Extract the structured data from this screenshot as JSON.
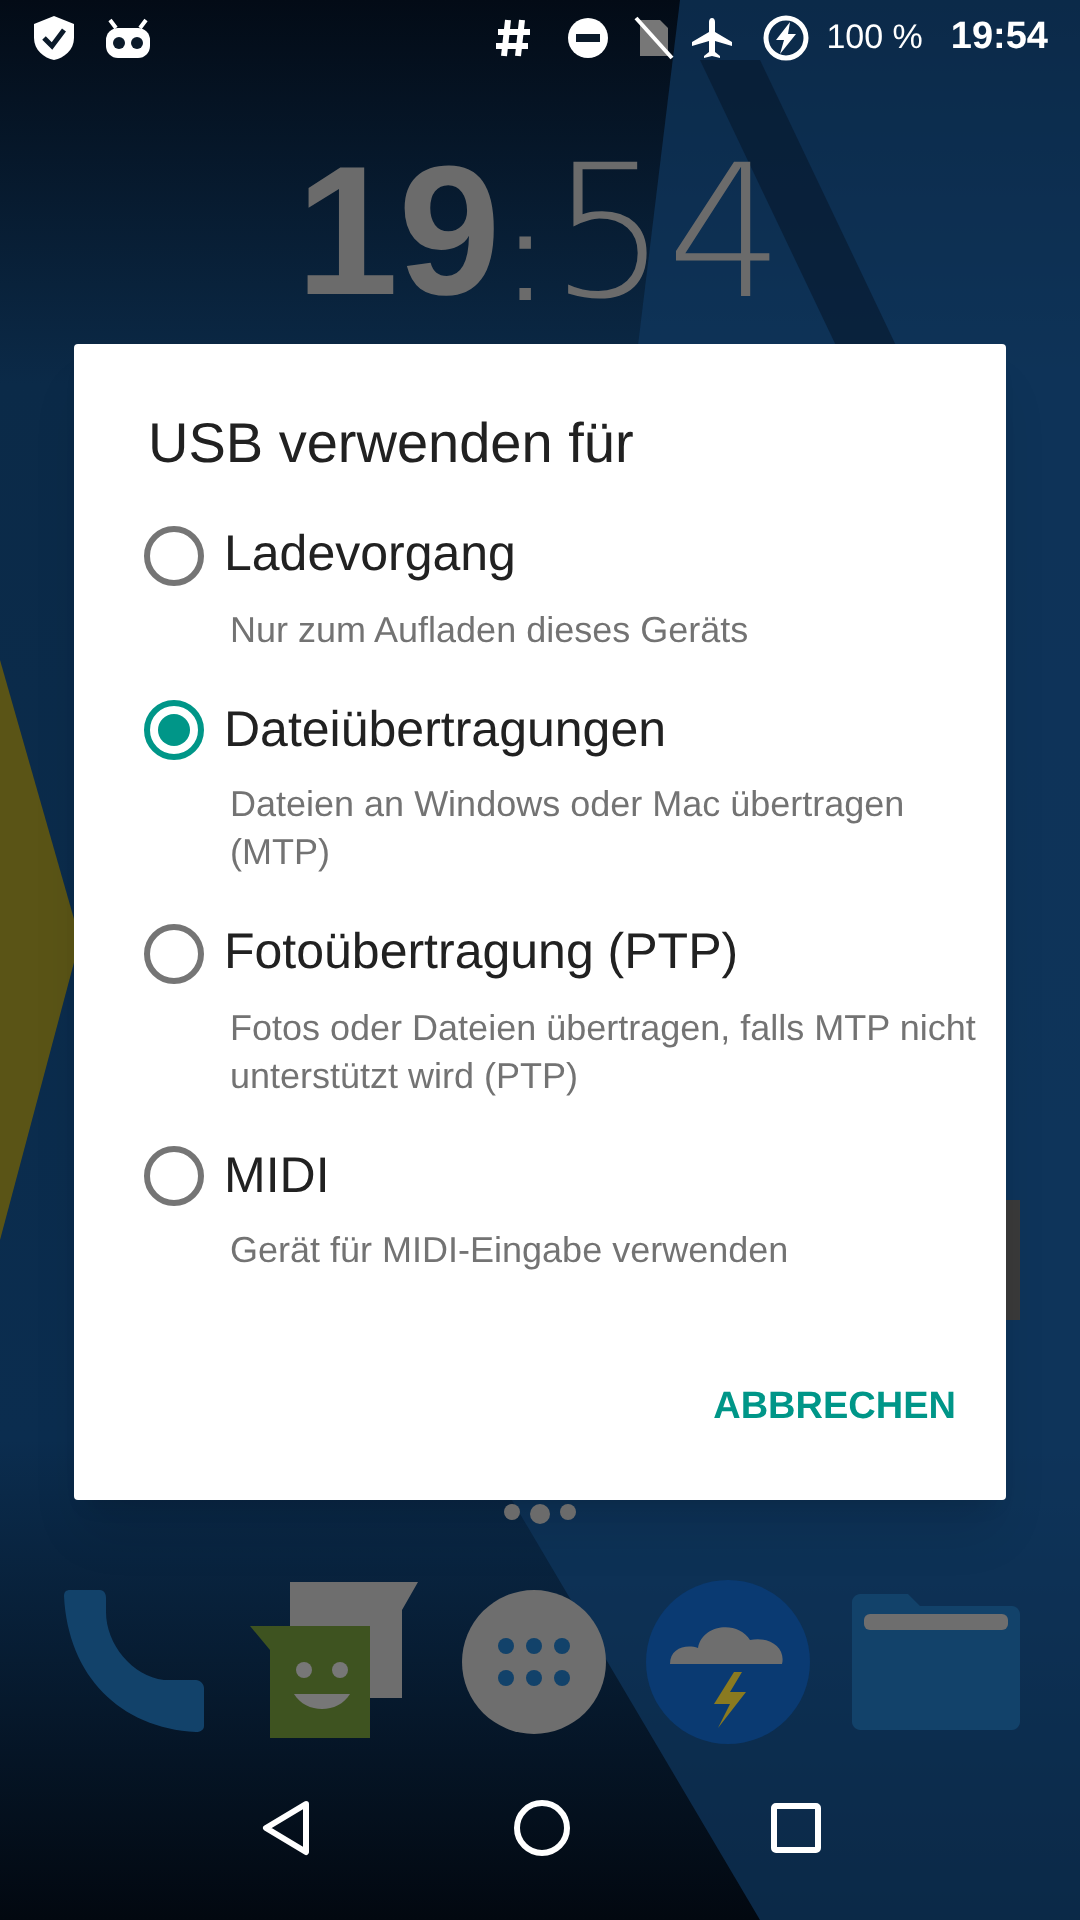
{
  "status_bar": {
    "battery": "100 %",
    "time": "19:54"
  },
  "lock_clock": {
    "hours": "19",
    "separator": ":",
    "minutes": "54"
  },
  "dialog": {
    "title": "USB verwenden für",
    "options": [
      {
        "label": "Ladevorgang",
        "description": "Nur zum Aufladen dieses Geräts",
        "selected": false
      },
      {
        "label": "Dateiübertragungen",
        "description": "Dateien an Windows oder Mac übertragen (MTP)",
        "selected": true
      },
      {
        "label": "Fotoübertragung (PTP)",
        "description": "Fotos oder Dateien übertragen, falls MTP nicht unterstützt wird (PTP)",
        "selected": false
      },
      {
        "label": "MIDI",
        "description": "Gerät für MIDI-Eingabe verwenden",
        "selected": false
      }
    ],
    "cancel_button": "ABBRECHEN"
  }
}
